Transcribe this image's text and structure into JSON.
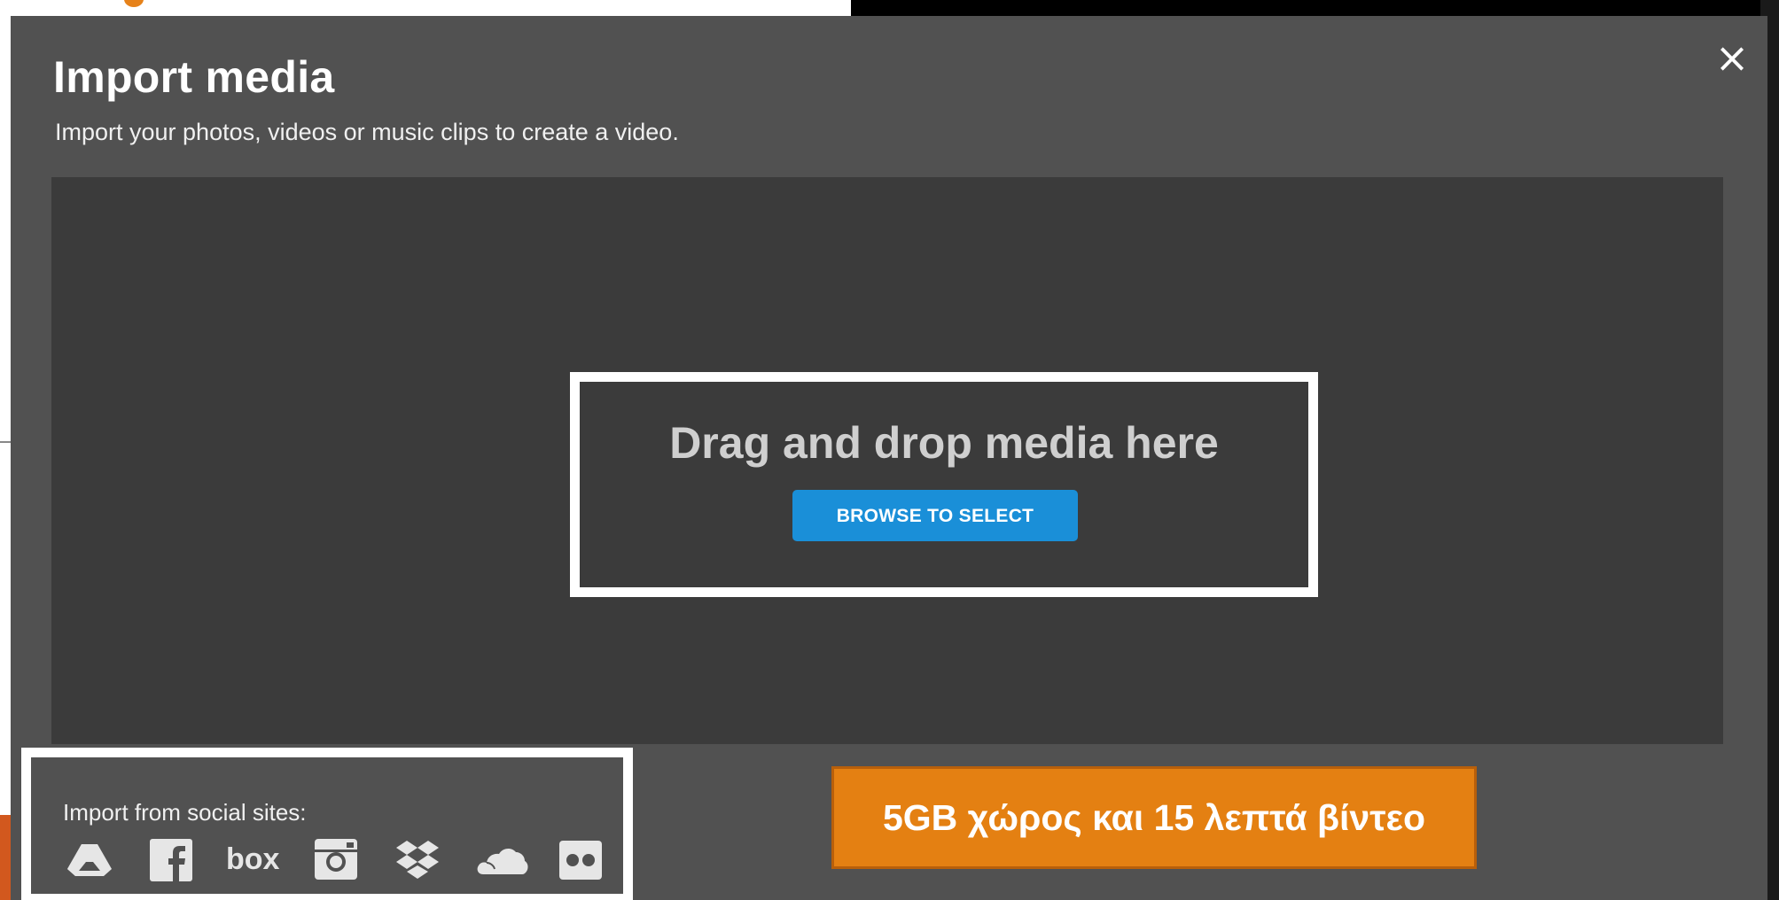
{
  "modal": {
    "title": "Import media",
    "subtitle": "Import your photos, videos or music clips to create a video.",
    "close_symbol": "×"
  },
  "dropzone": {
    "text": "Drag and drop media here",
    "browse_label": "BROWSE TO SELECT",
    "button_color": "#1a8fd8"
  },
  "social": {
    "label": "Import from social sites:",
    "services": [
      {
        "name": "Google Drive",
        "icon": "google-drive-icon"
      },
      {
        "name": "Facebook",
        "icon": "facebook-icon"
      },
      {
        "name": "Box",
        "icon": "box-icon",
        "text": "box"
      },
      {
        "name": "Instagram",
        "icon": "instagram-icon"
      },
      {
        "name": "Dropbox",
        "icon": "dropbox-icon"
      },
      {
        "name": "OneDrive",
        "icon": "onedrive-icon"
      },
      {
        "name": "Flickr",
        "icon": "flickr-icon"
      }
    ]
  },
  "promo": {
    "text": "5GB χώρος και 15 λεπτά βίντεο",
    "color": "#e48012"
  },
  "colors": {
    "modal_bg": "#515151",
    "dropzone_bg": "#3b3b3b",
    "highlight_border": "#ffffff"
  }
}
